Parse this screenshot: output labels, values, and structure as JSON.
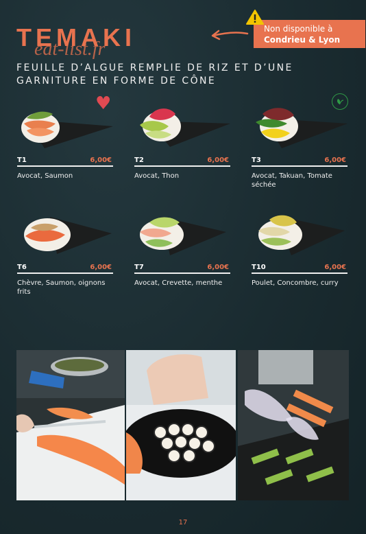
{
  "header": {
    "title": "TEMAKI",
    "watermark": "eat-list.fr",
    "subtitle": "FEUILLE D’ALGUE REMPLIE DE RIZ ET D’UNE GARNITURE EN FORME DE CÔNE"
  },
  "notice": {
    "line1": "Non disponible à",
    "line2": "Condrieu & Lyon"
  },
  "items": [
    {
      "code": "T1",
      "price": "6,00€",
      "desc": "Avocat, Saumon"
    },
    {
      "code": "T2",
      "price": "6,00€",
      "desc": "Avocat, Thon"
    },
    {
      "code": "T3",
      "price": "6,00€",
      "desc": "Avocat, Takuan, Tomate séchée"
    },
    {
      "code": "T6",
      "price": "6,00€",
      "desc": "Chèvre, Saumon, oignons frits"
    },
    {
      "code": "T7",
      "price": "6,00€",
      "desc": "Avocat, Crevette, menthe"
    },
    {
      "code": "T10",
      "price": "6,00€",
      "desc": "Poulet, Concombre, curry"
    }
  ],
  "icons": {
    "favorite": "heart-icon",
    "vegetarian": "vegetarian-leaf-icon",
    "warning": "warning-icon",
    "arrow": "arrow-left-icon"
  },
  "colors": {
    "accent": "#e8734f",
    "background": "#1a2b30",
    "heart": "#e04a52",
    "veg": "#2f9a46"
  },
  "page": {
    "number": "17"
  }
}
